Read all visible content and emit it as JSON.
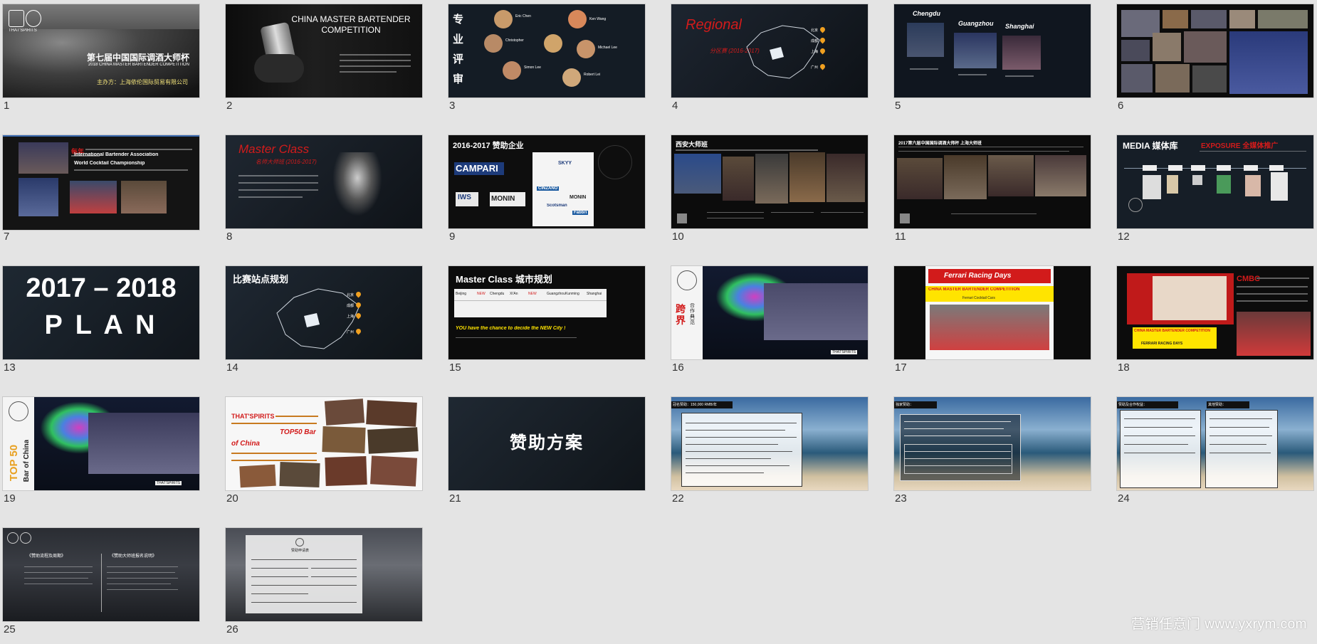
{
  "slides": [
    {
      "n": "1",
      "title": "第七届中国国际调酒大师杯",
      "sub": "2018 CHINA MASTER BARTENDER COMPETITION",
      "host": "主办方：上海依伦国际贸易有限公司",
      "logo": "THAT'SPIRITS"
    },
    {
      "n": "2",
      "title1": "CHINA MASTER BARTENDER",
      "title2": "COMPETITION"
    },
    {
      "n": "3",
      "side": "专业评审",
      "p1": "Eric Chen",
      "p2": "Ken Wang",
      "p3": "Christopher",
      "p4": "Michael Lee",
      "p5": "Simon Lee",
      "p6": "Robert Lei"
    },
    {
      "n": "4",
      "title": "Regional",
      "sub": "分区赛 (2016-2017)",
      "c1": "北京",
      "c2": "成都",
      "c3": "上海",
      "c4": "广州"
    },
    {
      "n": "5",
      "c1": "Chengdu",
      "c2": "Guangzhou",
      "c3": "Shanghai"
    },
    {
      "n": "6"
    },
    {
      "n": "7",
      "lead": "每年",
      "ib": "International Bartender Association",
      "wc": "World Cocktail Championship"
    },
    {
      "n": "8",
      "title": "Master Class",
      "sub": "名师大师班 (2016-2017)"
    },
    {
      "n": "9",
      "title": "2016-2017 赞助企业",
      "b1": "CAMPARI",
      "b2": "IWS",
      "b3": "MONIN",
      "b4": "SKYY",
      "b5": "MONIN",
      "b6": "Scotsman",
      "b7": "CINZANO",
      "b8": "Fabbri"
    },
    {
      "n": "10",
      "title": "西安大师班"
    },
    {
      "n": "11",
      "title": "2017第六届中国国际调酒大师杯 上海大师班"
    },
    {
      "n": "12",
      "title": "MEDIA 媒体库",
      "exp": "EXPOSURE 全媒体推广"
    },
    {
      "n": "13",
      "l1": "2017 – 2018",
      "l2": "P L A N"
    },
    {
      "n": "14",
      "title": "比赛站点规划",
      "c1": "北京",
      "c2": "成都",
      "c3": "上海",
      "c4": "广州"
    },
    {
      "n": "15",
      "title": "Master Class 城市规划",
      "cities": [
        "Beijing",
        "NEW",
        "Chengdu",
        "Xi'An",
        "NEW",
        "Guangzhou",
        "Kunming",
        "Shanghai"
      ],
      "cap": "YOU have the chance to decide the NEW City !"
    },
    {
      "n": "16",
      "side": "跨界",
      "sub": "合作典范",
      "logo": "THAT'SPIRITS"
    },
    {
      "n": "17",
      "brand": "Ferrari Racing Days",
      "band": "CHINA MASTER BARTENDER COMPETITION",
      "sub": "Ferrari Cocktail Cars"
    },
    {
      "n": "18",
      "lead": "CMBC",
      "band": "CHINA MASTER BARTENDER COMPETITION",
      "sub": "FERRARI RACING DAYS"
    },
    {
      "n": "19",
      "side": "TOP 50",
      "side2": "Bar of China",
      "logo": "THAT'SPIRITS"
    },
    {
      "n": "20",
      "t1": "THAT'SPIRITS",
      "t2": "TOP50 Bar",
      "t3": "of China"
    },
    {
      "n": "21",
      "title": "赞助方案"
    },
    {
      "n": "22",
      "head": "冠名赞助：150,000 RMB/年"
    },
    {
      "n": "23",
      "head": "独家赞助："
    },
    {
      "n": "24",
      "head": "赞助及合作权益：",
      "head2": "其他赞助："
    },
    {
      "n": "25",
      "h1": "《赞助流程及周期》",
      "h2": "《赞助大师班报名说明》"
    },
    {
      "n": "26",
      "head": "赞助申请表"
    }
  ],
  "watermark": "营销任意门 www.yxrym.com",
  "colors": {
    "red": "#d21b1b",
    "yellow": "#ffe400",
    "orange": "#f0a020",
    "dark": "#1a1d22"
  }
}
